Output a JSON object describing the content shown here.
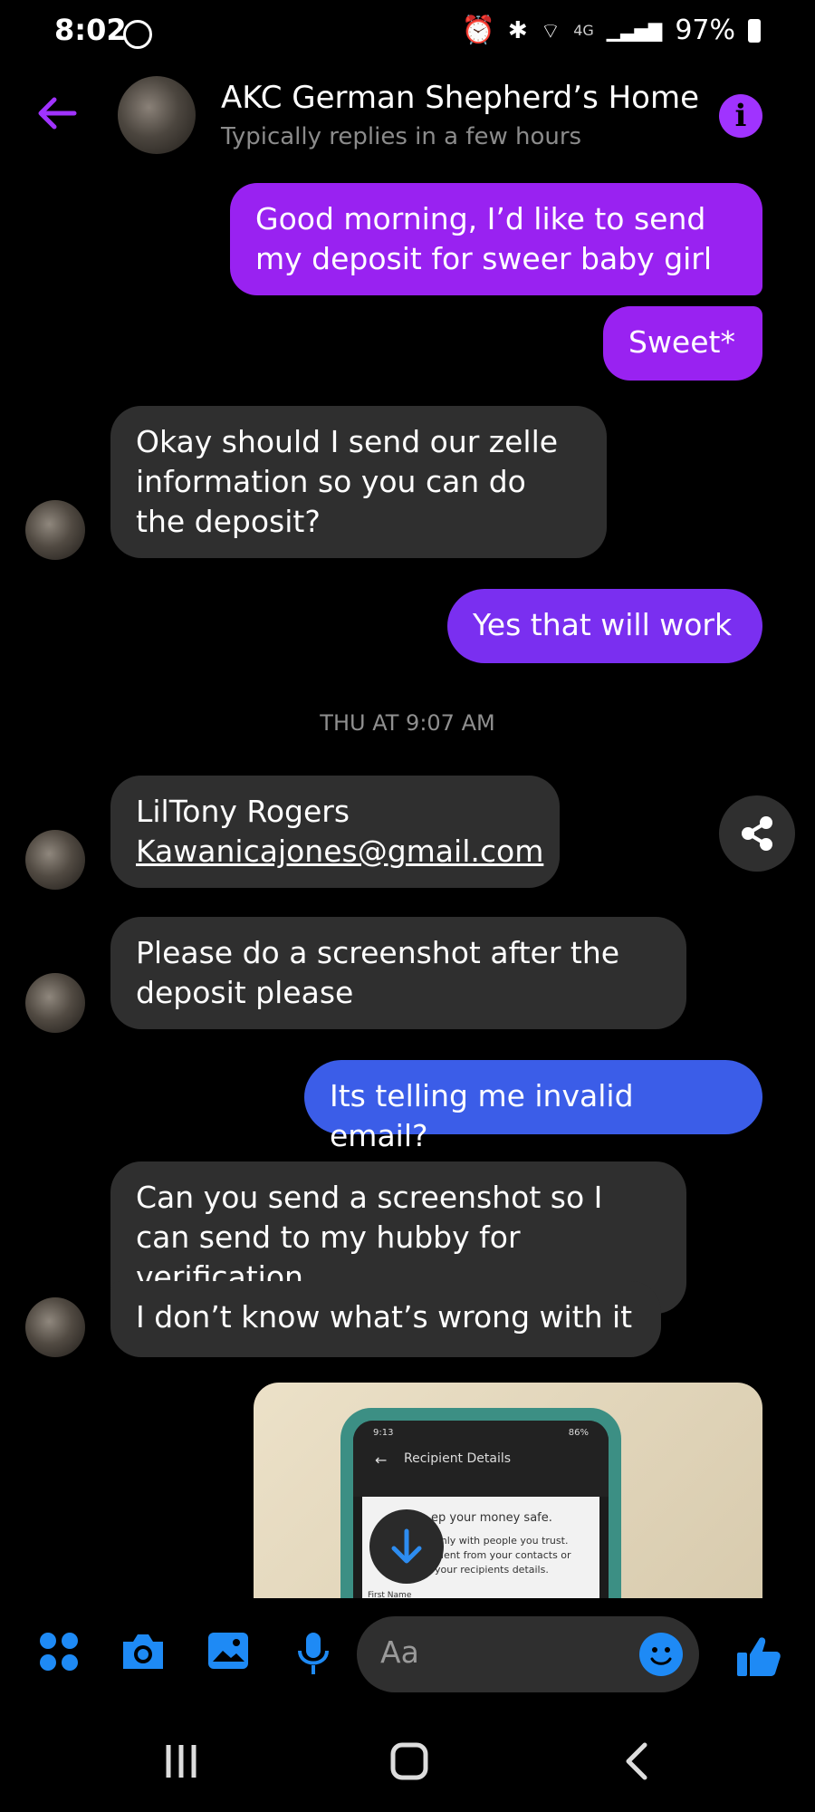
{
  "status_bar": {
    "time": "8:02",
    "network": "4G",
    "battery": "97%"
  },
  "header": {
    "title": "AKC German Shepherd’s Home",
    "subtitle": "Typically replies in a few hours"
  },
  "messages": [
    {
      "from": "me",
      "text": "Good morning, I’d like to send my deposit for sweer baby girl"
    },
    {
      "from": "me",
      "text": "Sweet*"
    },
    {
      "from": "them",
      "text": "Okay should I send our zelle information so you can do the deposit?"
    },
    {
      "from": "me",
      "text": "Yes that will work"
    },
    {
      "from": "them",
      "line1": "LilTony Rogers",
      "email": "Kawanicajones@gmail.com"
    },
    {
      "from": "them",
      "text": "Please do a screenshot after the deposit please"
    },
    {
      "from": "me",
      "text": "Its telling me invalid email?"
    },
    {
      "from": "them",
      "text": "Can you send a screenshot so I can send to my hubby for verification"
    },
    {
      "from": "them",
      "text": "I don’t know what’s wrong with it"
    }
  ],
  "timestamp": "THU AT 9:07 AM",
  "attachment": {
    "phone_time": "9:13",
    "phone_battery": "86%",
    "screen_title": "Recipient Details",
    "line1": "ep your money safe.",
    "line2": "only with people you trust.",
    "line3": "pient from your contacts or",
    "line4": "your recipients details.",
    "line5": "First Name"
  },
  "composer": {
    "placeholder": "Aa"
  },
  "colors": {
    "accent": "#a033ff",
    "outgoing_purple": "#9922f1",
    "outgoing_blue": "#3b5de8",
    "incoming": "#2f2f2f",
    "icon_blue": "#1e8af5"
  }
}
